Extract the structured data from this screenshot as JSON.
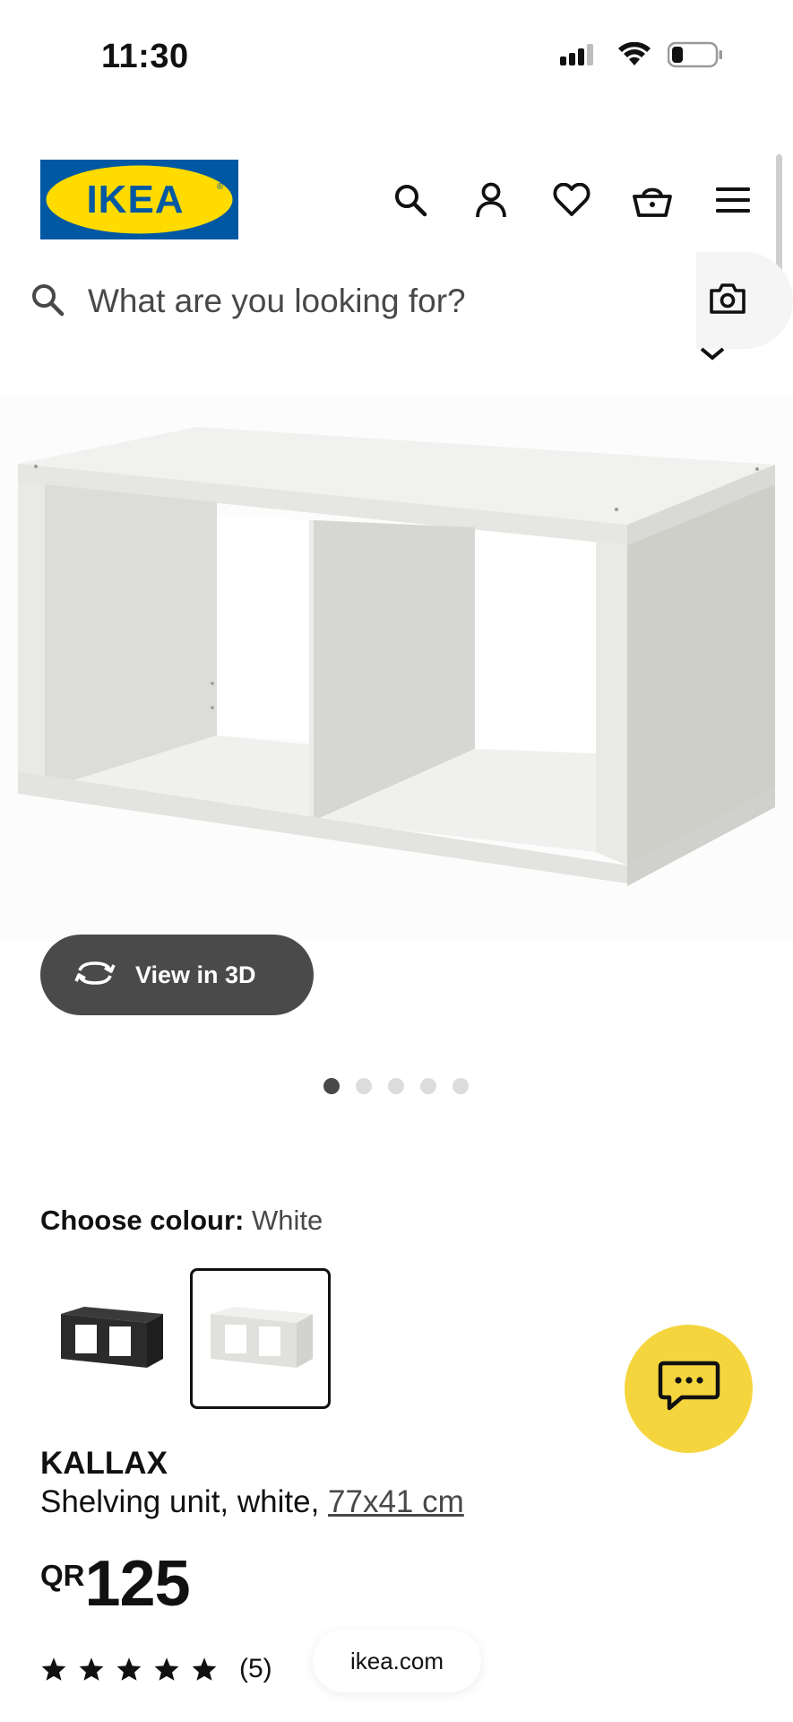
{
  "status_bar": {
    "time": "11:30"
  },
  "brand": {
    "logo_text": "IKEA",
    "registered": "®",
    "colors": {
      "blue": "#0058a3",
      "yellow": "#ffdb00"
    }
  },
  "header": {
    "icons": [
      "search-icon",
      "account-icon",
      "heart-icon",
      "basket-icon",
      "menu-icon"
    ]
  },
  "search": {
    "placeholder": "What are you looking for?"
  },
  "media": {
    "view3d_label": "View in 3D",
    "carousel_total": 5,
    "carousel_active": 1
  },
  "colour": {
    "label": "Choose colour:",
    "selected": "White",
    "options": [
      "black-brown",
      "white"
    ]
  },
  "product": {
    "name": "KALLAX",
    "description_prefix": "Shelving unit, white, ",
    "size": "77x41 cm",
    "currency": "QR",
    "price": "125",
    "rating_value": 5,
    "rating_count": "(5)"
  },
  "browser": {
    "url": "ikea.com"
  },
  "accent_colors": {
    "chat": "#f5d53d",
    "view3d": "#4a4a4a"
  }
}
